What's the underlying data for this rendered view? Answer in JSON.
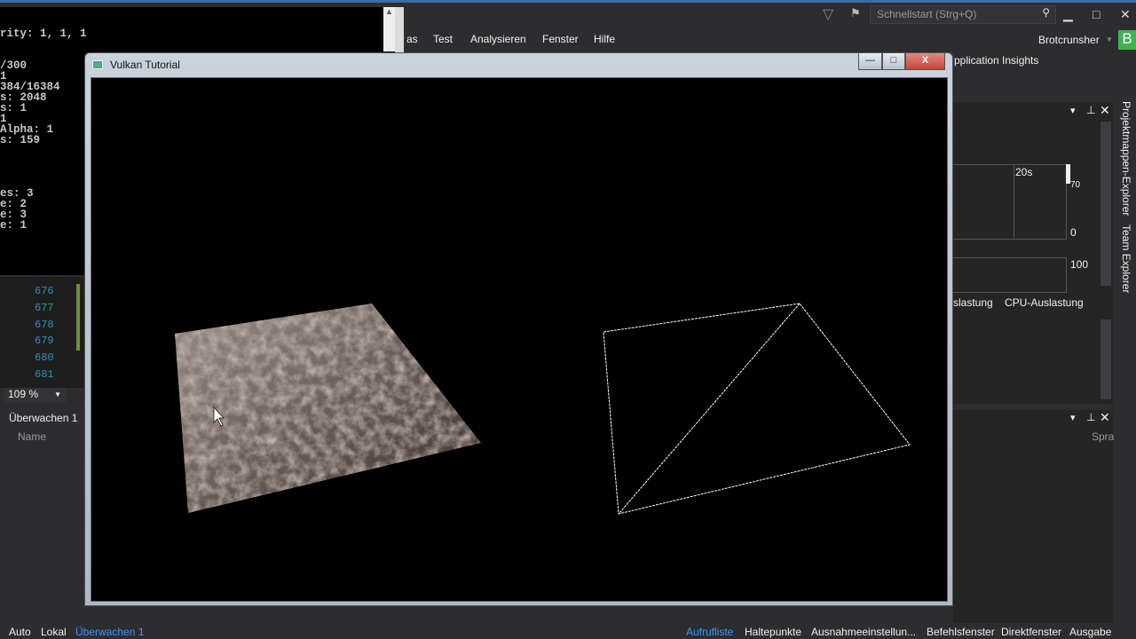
{
  "vs": {
    "menu": [
      "as",
      "Test",
      "Analysieren",
      "Fenster",
      "Hilfe"
    ],
    "quick_launch_placeholder": "Schnellstart (Strg+Q)",
    "user": "Brotcrunsher",
    "user_initial": "B",
    "app_insights": "pplication Insights",
    "diagnostics": {
      "time_label": "20s",
      "axis_top": "70",
      "axis_zero": "0",
      "axis_100": "100",
      "tab1": "slastung",
      "tab2": "CPU-Auslastung"
    },
    "side_tabs": [
      "Projektmappen-Explorer",
      "Team Explorer"
    ],
    "line_numbers": [
      "676",
      "677",
      "678",
      "679",
      "680",
      "681"
    ],
    "zoom": "109 %",
    "watch": {
      "title": "Überwachen 1",
      "column": "Name",
      "right_column": "Spra"
    },
    "bottom_left_tabs": [
      "Auto",
      "Lokal",
      "Überwachen 1"
    ],
    "bottom_right_tabs": [
      "Aufrufliste",
      "Haltepunkte",
      "Ausnahmeeinstellun...",
      "Befehlsfenster",
      "Direktfenster",
      "Ausgabe"
    ]
  },
  "console": {
    "lines": [
      "rity: 1, 1, 1",
      "",
      "",
      "/300",
      "1",
      "384/16384",
      "s: 2048",
      "s: 1",
      "1",
      "Alpha: 1",
      "s: 159",
      "",
      "",
      "",
      "",
      "es: 3",
      "e: 2",
      "e: 3",
      "e: 1"
    ]
  },
  "vulkan_window": {
    "title": "Vulkan Tutorial",
    "minimize": "—",
    "maximize": "□",
    "close": "X"
  },
  "colors": {
    "accent": "#3399ff",
    "bg": "#2d2d30",
    "close": "#c7453b"
  }
}
